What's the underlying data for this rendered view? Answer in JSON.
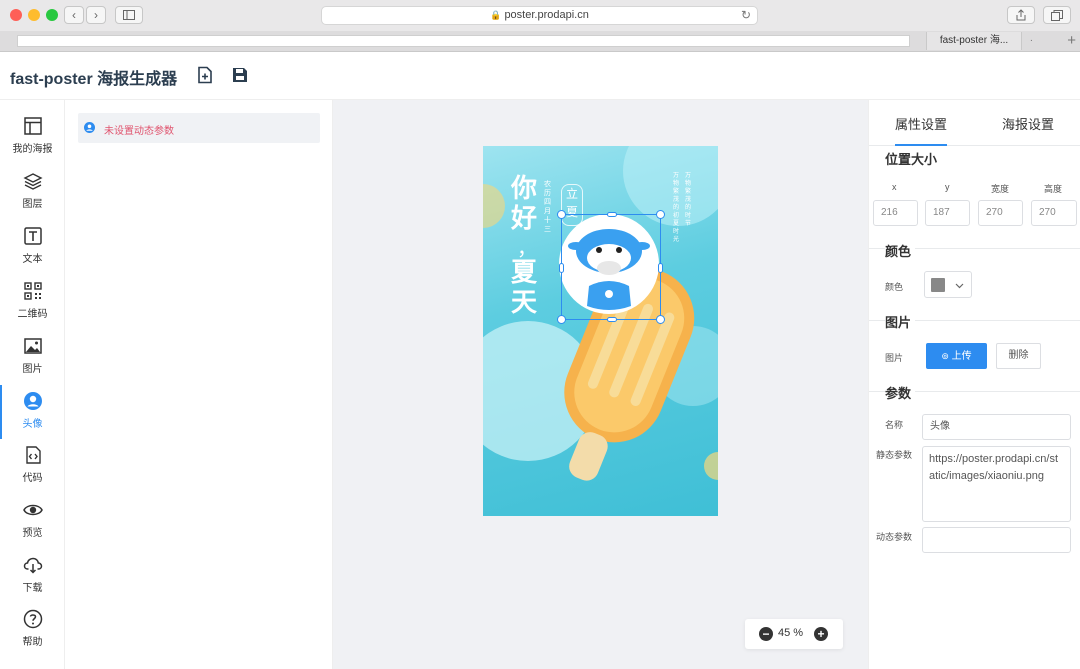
{
  "browser": {
    "url": "poster.prodapi.cn",
    "tab_title": "fast-poster 海...",
    "tab_dot": "."
  },
  "app": {
    "title": "fast-poster 海报生成器"
  },
  "nav": [
    {
      "label": "我的海报",
      "icon": "layout-icon"
    },
    {
      "label": "图层",
      "icon": "layers-icon"
    },
    {
      "label": "文本",
      "icon": "text-icon"
    },
    {
      "label": "二维码",
      "icon": "qrcode-icon"
    },
    {
      "label": "图片",
      "icon": "image-icon"
    },
    {
      "label": "头像",
      "icon": "avatar-icon"
    },
    {
      "label": "代码",
      "icon": "code-icon"
    },
    {
      "label": "预览",
      "icon": "eye-icon"
    },
    {
      "label": "下载",
      "icon": "cloud-download-icon"
    },
    {
      "label": "帮助",
      "icon": "help-icon"
    }
  ],
  "params": {
    "empty_text": "未设置动态参数"
  },
  "poster": {
    "main_text_1": "你好",
    "comma": "，",
    "main_text_2": "夏天",
    "date_text": "农历四月十三",
    "badge_1": "立",
    "badge_2": "夏",
    "poem_col_1": "万物繁茂的时节",
    "poem_col_2": "万物繁茂的初夏时光",
    "colors": {
      "bg_top": "#9ee4f0",
      "bg_bottom": "#3fbfd6",
      "selection": "#2d8cf0",
      "popsicle": "#f7b54a"
    }
  },
  "zoom": {
    "minus": "−",
    "value": "45 %",
    "plus": "+"
  },
  "panel": {
    "tabs": [
      "属性设置",
      "海报设置"
    ],
    "position_size": {
      "title": "位置大小",
      "labels": [
        "x",
        "y",
        "宽度",
        "高度"
      ],
      "values": [
        "216",
        "187",
        "270",
        "270"
      ]
    },
    "color": {
      "title": "颜色",
      "label": "颜色",
      "value": "#888888"
    },
    "image": {
      "title": "图片",
      "label": "图片",
      "upload_label": "上传",
      "delete_label": "删除"
    },
    "params": {
      "title": "参数",
      "name_label": "名称",
      "name_value": "头像",
      "static_label": "静态参数",
      "static_value": "https://poster.prodapi.cn/static/images/xiaoniu.png",
      "dynamic_label": "动态参数",
      "dynamic_value": ""
    }
  }
}
